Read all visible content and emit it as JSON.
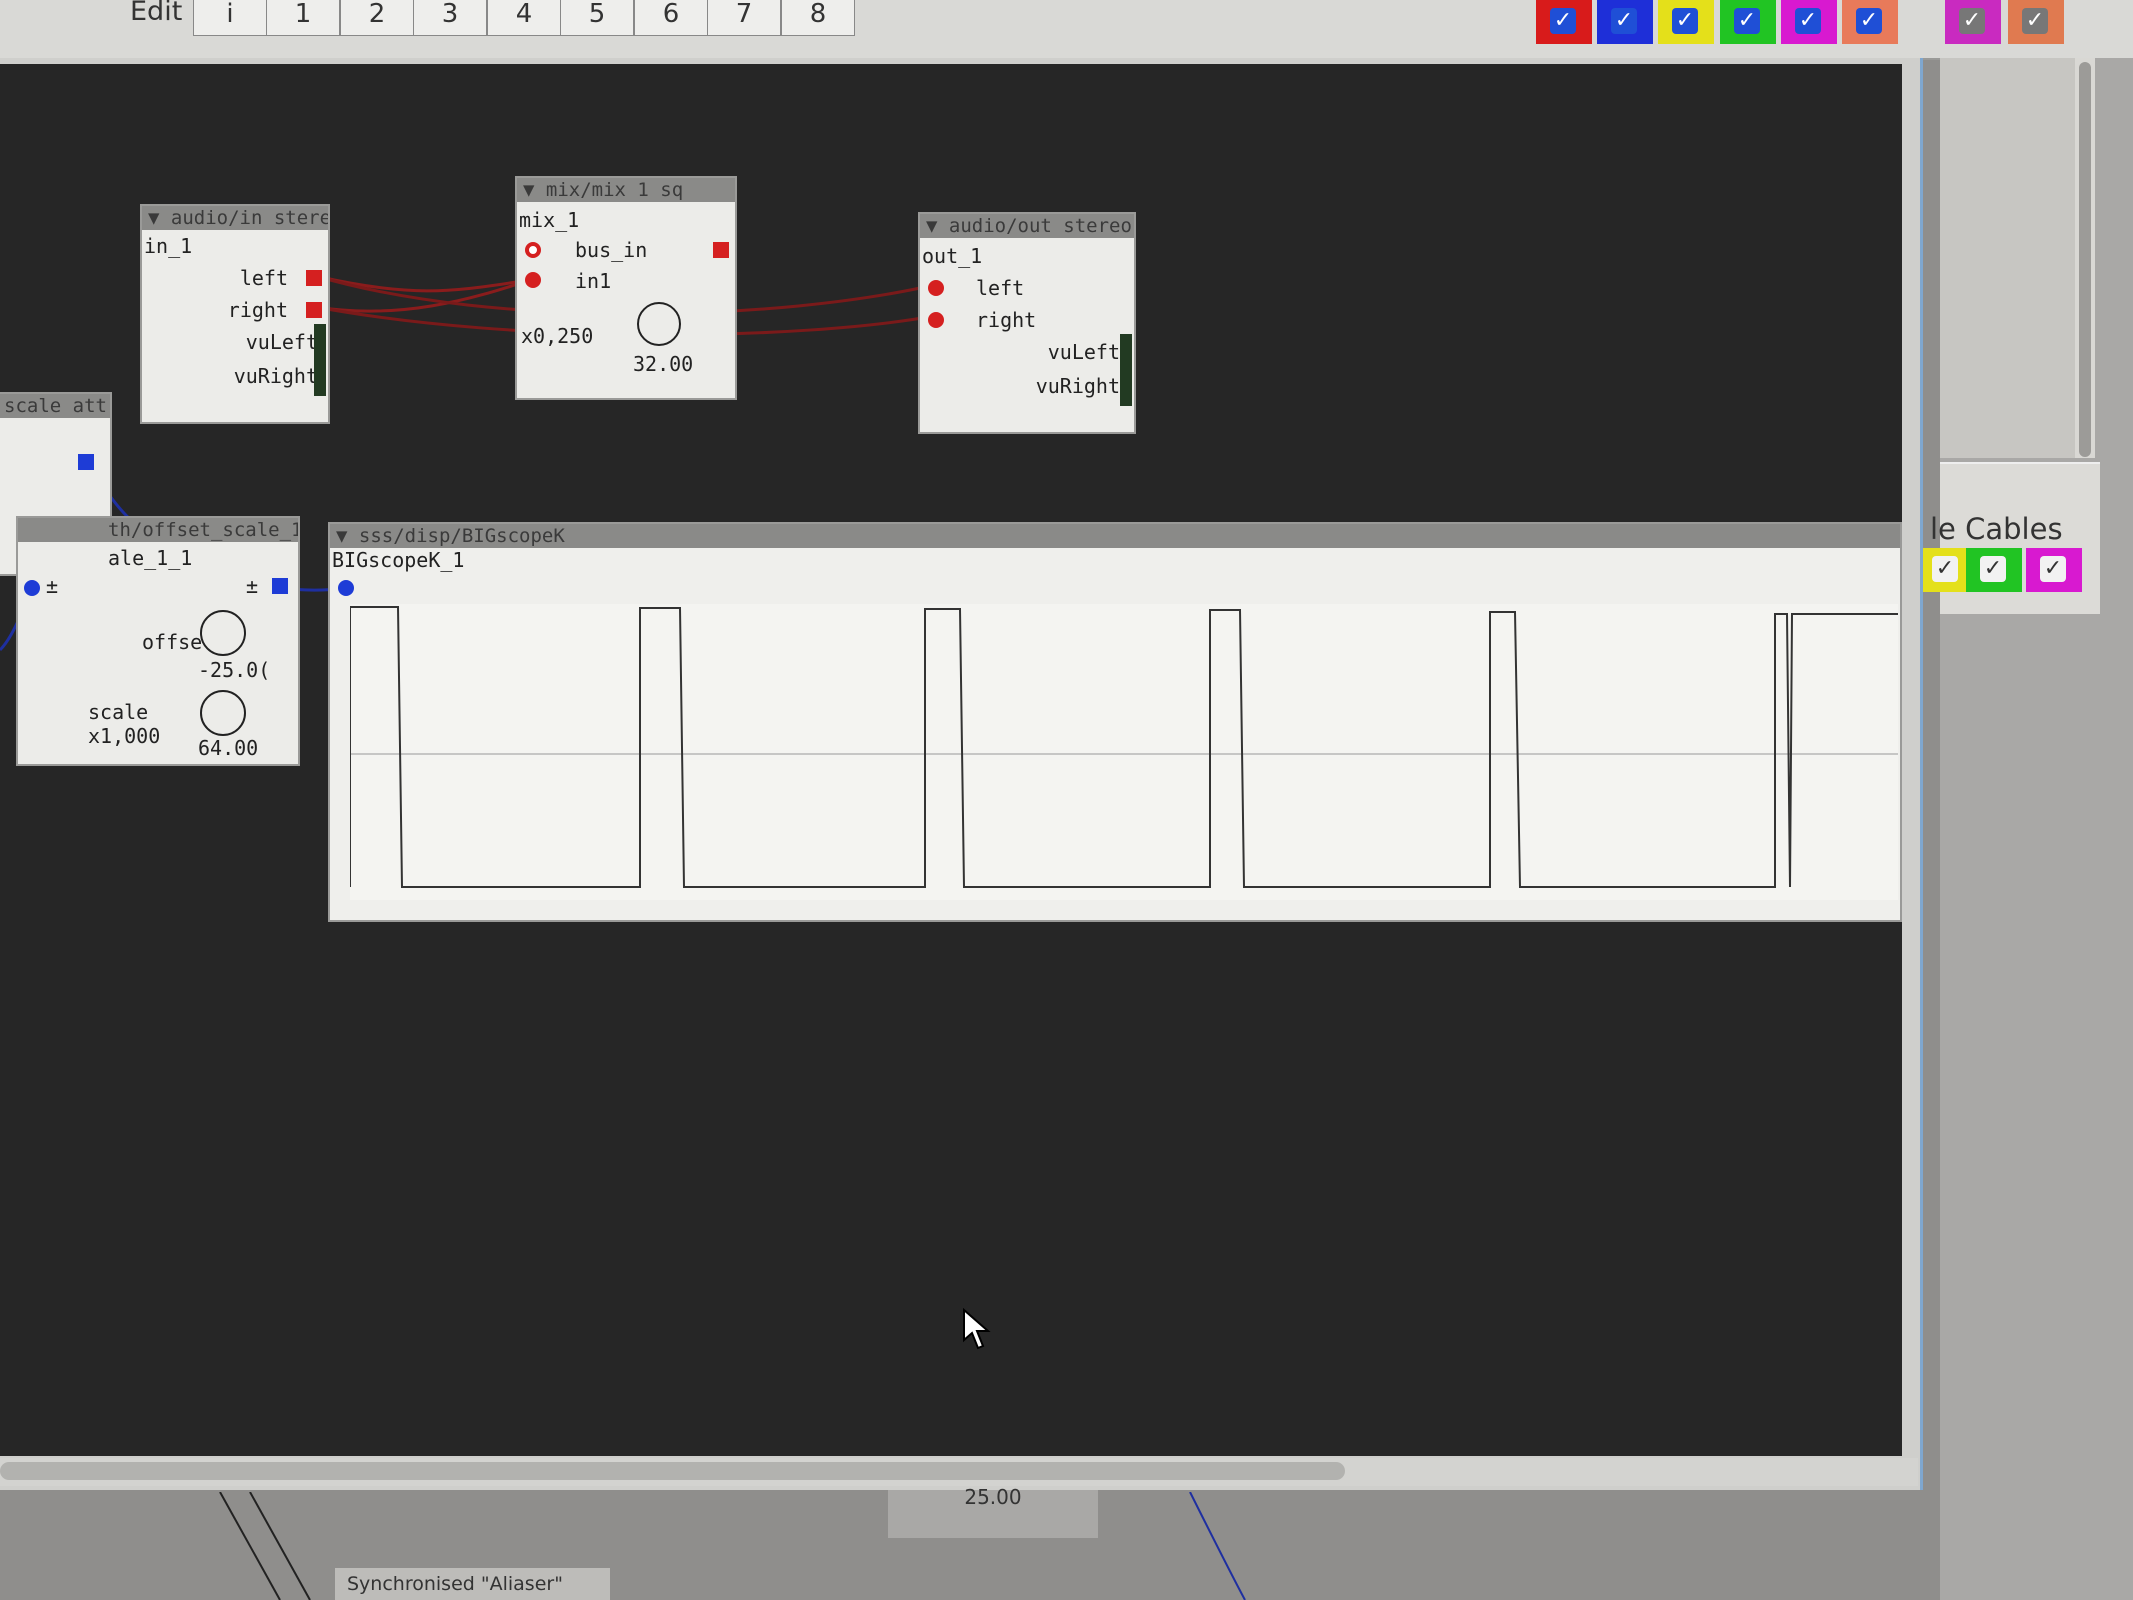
{
  "toolbar": {
    "edit_label": "Edit",
    "tabs": [
      "i",
      "1",
      "2",
      "3",
      "4",
      "5",
      "6",
      "7",
      "8"
    ],
    "checkbox_colors": [
      "#d81b1b",
      "#1e2fd8",
      "#e4e01a",
      "#21c423",
      "#d819d0",
      "#e87a5a",
      "#c92ac0",
      "#e07a50"
    ]
  },
  "side_panel": {
    "cables_label": "le Cables",
    "checkbox_colors": [
      "#e4e01a",
      "#21c423",
      "#d819d0"
    ]
  },
  "objects": {
    "audio_in": {
      "type": "▼ audio/in stereo",
      "instance": "in_1",
      "outlets": [
        "left",
        "right",
        "vuLeft",
        "vuRight"
      ]
    },
    "mix": {
      "type": "▼ mix/mix 1 sq",
      "instance": "mix_1",
      "inlets": [
        "bus_in",
        "in1"
      ],
      "gain": "x0,250",
      "knob_value": "32.00"
    },
    "audio_out": {
      "type": "▼ audio/out stereo",
      "instance": "out_1",
      "inlets": [
        "left",
        "right"
      ],
      "outlets": [
        "vuLeft",
        "vuRight"
      ]
    },
    "scale_attr": {
      "type": "scale attr"
    },
    "offset_scale": {
      "type": "th/offset_scale_1",
      "instance": "ale_1_1",
      "plusminus": "±",
      "offset_label": "offset",
      "offset_value": "-25.0(",
      "scale_label": "scale",
      "scale_gain": "x1,000",
      "scale_value": "64.00"
    },
    "scope": {
      "type": "▼ sss/disp/BIGscopeK",
      "instance": "BIGscopeK_1"
    }
  },
  "bottom": {
    "status": "Synchronised \"Aliaser\"",
    "value": "25.00"
  }
}
